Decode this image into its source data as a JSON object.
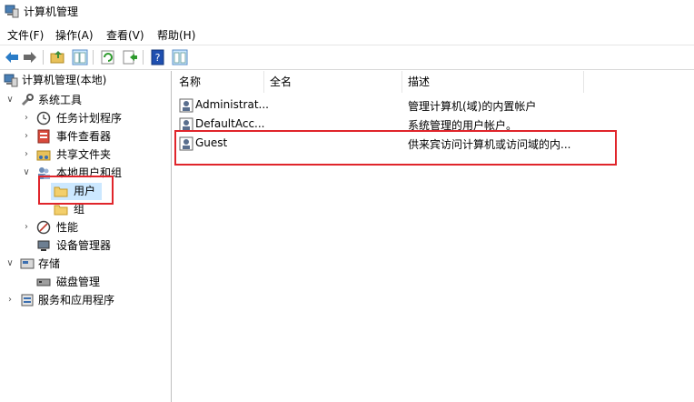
{
  "window": {
    "title": "计算机管理"
  },
  "menu": [
    "文件(F)",
    "操作(A)",
    "查看(V)",
    "帮助(H)"
  ],
  "toolbar": {
    "icons": [
      "back-arrow-icon",
      "forward-arrow-icon",
      "up-folder-icon",
      "show-hide-tree-icon",
      "refresh-icon",
      "export-list-icon",
      "help-icon",
      "properties-icon"
    ]
  },
  "tree": {
    "root": "计算机管理(本地)",
    "system_tools": "系统工具",
    "task_scheduler": "任务计划程序",
    "event_viewer": "事件查看器",
    "shared_folders": "共享文件夹",
    "local_users_groups": "本地用户和组",
    "users": "用户",
    "groups": "组",
    "performance": "性能",
    "device_manager": "设备管理器",
    "storage": "存储",
    "disk_management": "磁盘管理",
    "services_apps": "服务和应用程序"
  },
  "list": {
    "columns": [
      "名称",
      "全名",
      "描述"
    ],
    "rows": [
      {
        "name": "Administrat...",
        "full_name": "",
        "description": "管理计算机(域)的内置帐户"
      },
      {
        "name": "DefaultAcc...",
        "full_name": "",
        "description": "系统管理的用户帐户。"
      },
      {
        "name": "Guest",
        "full_name": "",
        "description": "供来宾访问计算机或访问域的内..."
      }
    ]
  },
  "colors": {
    "selection": "#cce8ff",
    "highlight_box": "#e0252b"
  }
}
